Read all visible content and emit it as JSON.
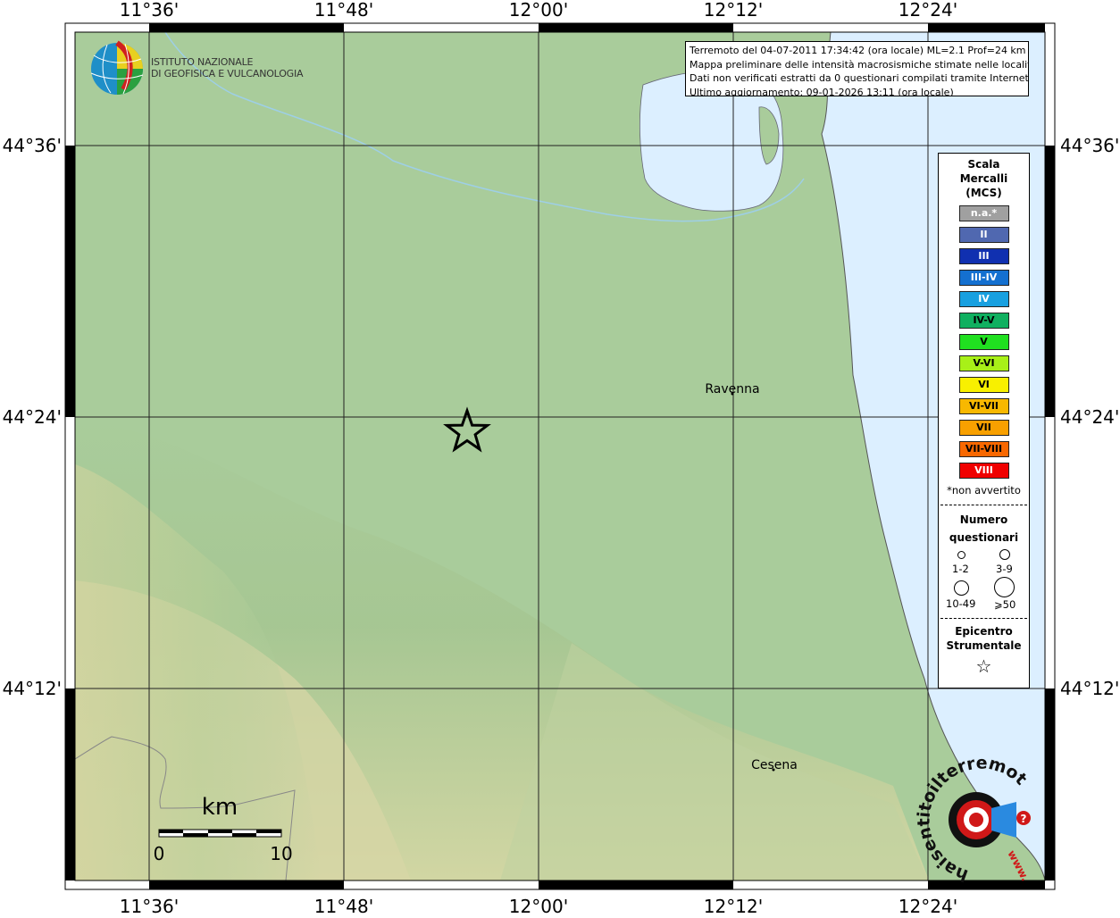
{
  "map": {
    "top_labels": [
      "11°36'",
      "11°48'",
      "12°00'",
      "12°12'",
      "12°24'"
    ],
    "bottom_labels": [
      "11°36'",
      "11°48'",
      "12°00'",
      "12°12'",
      "12°24'"
    ],
    "left_labels": [
      "44°36'",
      "44°24'",
      "44°12'"
    ],
    "right_labels": [
      "44°36'",
      "44°24'",
      "44°12'"
    ],
    "cities": [
      {
        "name": "Ravenna",
        "lon": 12.2,
        "lat": 44.417
      },
      {
        "name": "Cesena",
        "lon": 12.245,
        "lat": 44.137
      }
    ],
    "epicenter": {
      "lon": 11.897,
      "lat": 44.397,
      "symbol": "☆"
    },
    "scalebar": {
      "unit": "km",
      "start_label": "0",
      "end_label": "10"
    },
    "colors": {
      "land": "#a9cc9b",
      "sea": "#dcefff",
      "river": "#9ecfe6"
    }
  },
  "logo": {
    "line1": "ISTITUTO NAZIONALE",
    "line2": "DI GEOFISICA E VULCANOLOGIA"
  },
  "info": {
    "line1": "Terremoto del 04-07-2011 17:34:42 (ora locale) ML=2.1 Prof=24 km",
    "line2": "Mappa preliminare delle intensità macrosismiche stimate nelle località",
    "line3": "Dati non verificati estratti da 0 questionari compilati tramite Internet.",
    "line4": "Ultimo aggiornamento: 09-01-2026 13:11 (ora locale)"
  },
  "legend": {
    "title_line1": "Scala",
    "title_line2": "Mercalli",
    "title_line3": "(MCS)",
    "scale": [
      {
        "label": "n.a.*",
        "color": "#a0a0a0",
        "dark": false
      },
      {
        "label": "II",
        "color": "#5068b0",
        "dark": false
      },
      {
        "label": "III",
        "color": "#1030b0",
        "dark": false
      },
      {
        "label": "III-IV",
        "color": "#1470d0",
        "dark": false
      },
      {
        "label": "IV",
        "color": "#18a0e0",
        "dark": false
      },
      {
        "label": "IV-V",
        "color": "#10b060",
        "dark": true
      },
      {
        "label": "V",
        "color": "#20e020",
        "dark": true
      },
      {
        "label": "V-VI",
        "color": "#a8f018",
        "dark": true
      },
      {
        "label": "VI",
        "color": "#f8f000",
        "dark": true
      },
      {
        "label": "VI-VII",
        "color": "#f8b800",
        "dark": true
      },
      {
        "label": "VII",
        "color": "#f8a000",
        "dark": true
      },
      {
        "label": "VII-VIII",
        "color": "#f86800",
        "dark": true
      },
      {
        "label": "VIII",
        "color": "#f00000",
        "dark": false
      }
    ],
    "note": "*non avvertito",
    "numero_line1": "Numero",
    "numero_line2": "questionari",
    "counts": [
      "1-2",
      "3-9",
      "10-49",
      "⩾50"
    ],
    "epicentro_line1": "Epicentro",
    "epicentro_line2": "Strumentale",
    "star_symbol": "☆"
  },
  "badge": {
    "text": "haisentitoilterremoto.it",
    "url_text": "www.",
    "question": "?"
  }
}
